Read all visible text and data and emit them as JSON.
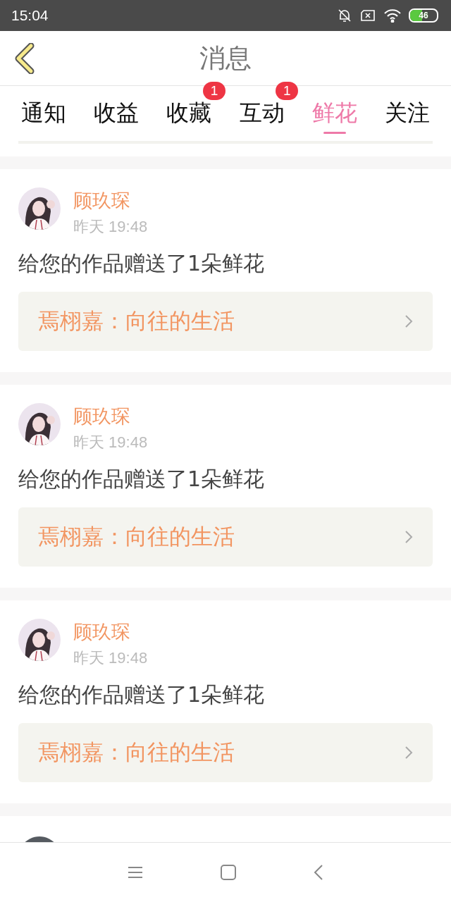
{
  "status_bar": {
    "time": "15:04",
    "battery": "46"
  },
  "header": {
    "title": "消息"
  },
  "tabs": [
    {
      "label": "通知",
      "selected": false
    },
    {
      "label": "收益",
      "selected": false
    },
    {
      "label": "收藏",
      "selected": false,
      "badge": "1"
    },
    {
      "label": "互动",
      "selected": false,
      "badge": "1"
    },
    {
      "label": "鲜花",
      "selected": true
    },
    {
      "label": "关注",
      "selected": false
    }
  ],
  "messages": [
    {
      "sender": "顾玖琛",
      "time": "昨天 19:48",
      "text": "给您的作品赠送了1朵鲜花",
      "work": "焉栩嘉：向往的生活"
    },
    {
      "sender": "顾玖琛",
      "time": "昨天 19:48",
      "text": "给您的作品赠送了1朵鲜花",
      "work": "焉栩嘉：向往的生活"
    },
    {
      "sender": "顾玖琛",
      "time": "昨天 19:48",
      "text": "给您的作品赠送了1朵鲜花",
      "work": "焉栩嘉：向往的生活"
    }
  ]
}
